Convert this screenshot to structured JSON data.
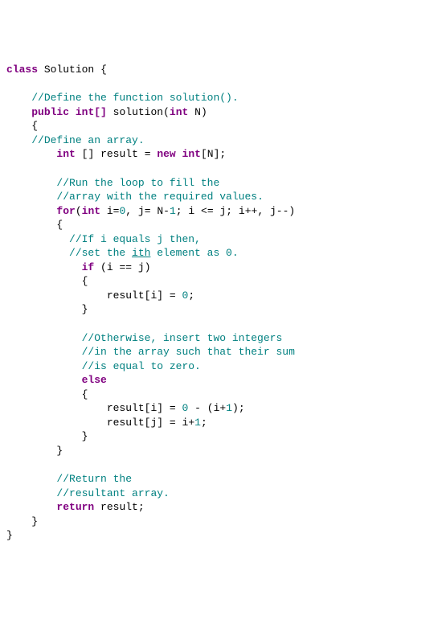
{
  "code": {
    "kw": {
      "class": "class",
      "public": "public",
      "int": "int",
      "int_arr": "int[]",
      "new": "new",
      "for": "for",
      "if": "if",
      "else": "else",
      "return": "return"
    },
    "id": {
      "Solution": "Solution",
      "solution": "solution",
      "N": "N",
      "result": "result",
      "i": "i",
      "j": "j",
      "ith": "ith"
    },
    "cm": {
      "c1": "//Define the function solution().",
      "c2": "//Define an array.",
      "c3": "//Run the loop to fill the",
      "c4": "//array with the required values.",
      "c5a": "//If i equals j then,",
      "c5b": "//set the ",
      "c5c": " element as 0.",
      "c6": "//Otherwise, insert two integers",
      "c7": "//in the array such that their sum",
      "c8": "//is equal to zero.",
      "c9": "//Return the",
      "c10": "//resultant array."
    },
    "num": {
      "zero": "0",
      "one": "1"
    },
    "sym": {
      "lbrace": "{",
      "rbrace": "}",
      "lparen": "(",
      "rparen": ")",
      "lbrack": "[",
      "rbrack": "]",
      "semi": ";",
      "comma": ",",
      "eq": "=",
      "eqeq": "==",
      "le": "<=",
      "inc": "++",
      "dec": "--",
      "minus": "-",
      "plus": "+",
      "sp": " "
    }
  }
}
